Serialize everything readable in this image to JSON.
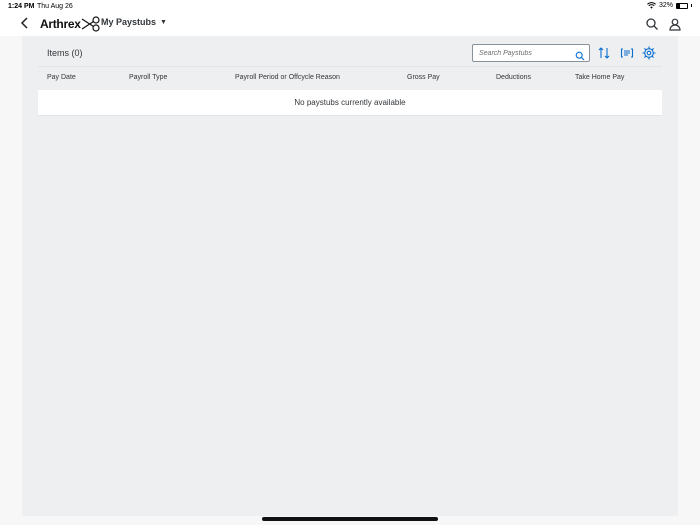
{
  "status_bar": {
    "time": "1:24 PM",
    "date": "Thu Aug 26",
    "battery": "32%"
  },
  "header": {
    "logo_text": "Arthrex",
    "title": "My Paystubs"
  },
  "toolbar": {
    "items_title": "Items (0)",
    "search_placeholder": "Search Paystubs"
  },
  "table": {
    "columns": [
      "Pay Date",
      "Payroll Type",
      "Payroll Period or Offcycle Reason",
      "Gross Pay",
      "Deductions",
      "Take Home Pay"
    ],
    "empty_message": "No paystubs currently available"
  },
  "colors": {
    "accent": "#0a6ed1",
    "background": "#edeff0"
  }
}
